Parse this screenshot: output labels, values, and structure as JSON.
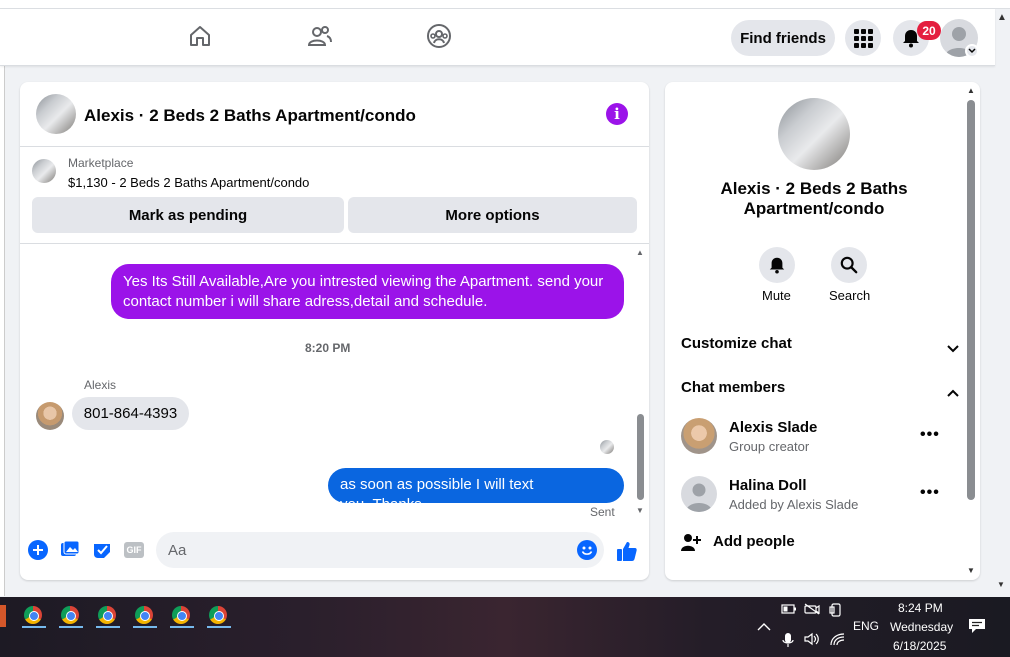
{
  "topbar": {
    "find_friends_label": "Find friends",
    "notifications_count": "20"
  },
  "chat": {
    "title": "Alexis · 2 Beds 2 Baths Apartment/condo",
    "marketplace_label": "Marketplace",
    "listing": "$1,130 - 2 Beds 2 Baths Apartment/condo",
    "mark_pending_label": "Mark as pending",
    "more_options_label": "More options",
    "messages": {
      "outgoing_1": "Yes Its Still Available,Are you intrested viewing the Apartment. send your contact number i will share adress,detail and schedule.",
      "timestamp": "8:20 PM",
      "sender_name": "Alexis",
      "incoming_1": "801-864-4393",
      "outgoing_2": "as soon as possible I will text you..Thanks",
      "status": "Sent"
    },
    "composer_placeholder": "Aa",
    "gif_label": "GIF"
  },
  "info_panel": {
    "title": "Alexis · 2 Beds 2 Baths Apartment/condo",
    "mute_label": "Mute",
    "search_label": "Search",
    "customize_chat_label": "Customize chat",
    "chat_members_label": "Chat members",
    "members": [
      {
        "name": "Alexis Slade",
        "subtitle": "Group creator"
      },
      {
        "name": "Halina Doll",
        "subtitle": "Added by Alexis Slade"
      }
    ],
    "more_label": "•••",
    "add_people_label": "Add people"
  },
  "taskbar": {
    "language": "ENG",
    "time": "8:24 PM",
    "day": "Wednesday",
    "date": "6/18/2025"
  },
  "colors": {
    "purple_bubble": "#9b13e9",
    "blue_bubble": "#0a66e0",
    "accent_blue": "#0866ff",
    "badge_red": "#e41e3f"
  }
}
